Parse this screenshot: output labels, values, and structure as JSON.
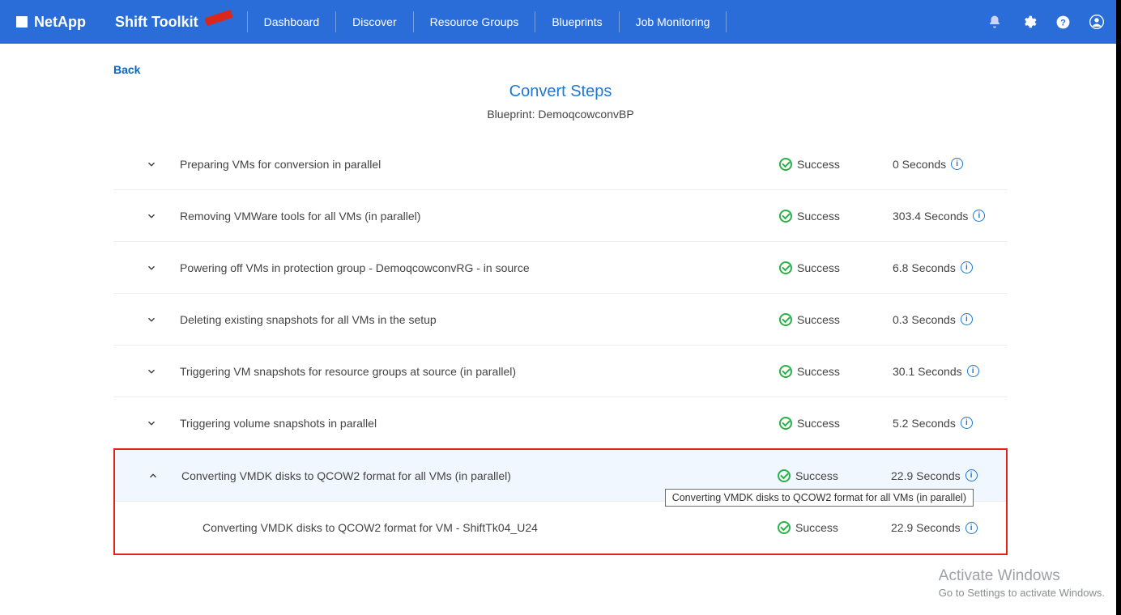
{
  "brand": "NetApp",
  "toolkit": "Shift Toolkit",
  "nav": [
    "Dashboard",
    "Discover",
    "Resource Groups",
    "Blueprints",
    "Job Monitoring"
  ],
  "back": "Back",
  "title": "Convert Steps",
  "blueprint_label": "Blueprint:",
  "blueprint_name": "DemoqcowconvBP",
  "status_text": "Success",
  "info_char": "i",
  "steps": [
    {
      "desc": "Preparing VMs for conversion in parallel",
      "duration": "0 Seconds",
      "expanded": false
    },
    {
      "desc": "Removing VMWare tools for all VMs (in parallel)",
      "duration": "303.4 Seconds",
      "expanded": false
    },
    {
      "desc": "Powering off VMs in protection group - DemoqcowconvRG - in source",
      "duration": "6.8 Seconds",
      "expanded": false
    },
    {
      "desc": "Deleting existing snapshots for all VMs in the setup",
      "duration": "0.3 Seconds",
      "expanded": false
    },
    {
      "desc": "Triggering VM snapshots for resource groups at source (in parallel)",
      "duration": "30.1 Seconds",
      "expanded": false
    },
    {
      "desc": "Triggering volume snapshots in parallel",
      "duration": "5.2 Seconds",
      "expanded": false
    }
  ],
  "highlight": {
    "parent": {
      "desc": "Converting VMDK disks to QCOW2 format for all VMs (in parallel)",
      "duration": "22.9 Seconds"
    },
    "child": {
      "desc": "Converting VMDK disks to QCOW2 format for VM - ShiftTk04_U24",
      "duration": "22.9 Seconds"
    }
  },
  "tooltip": "Converting VMDK disks to QCOW2 format for all VMs (in parallel)",
  "watermark": {
    "title": "Activate Windows",
    "sub": "Go to Settings to activate Windows."
  }
}
